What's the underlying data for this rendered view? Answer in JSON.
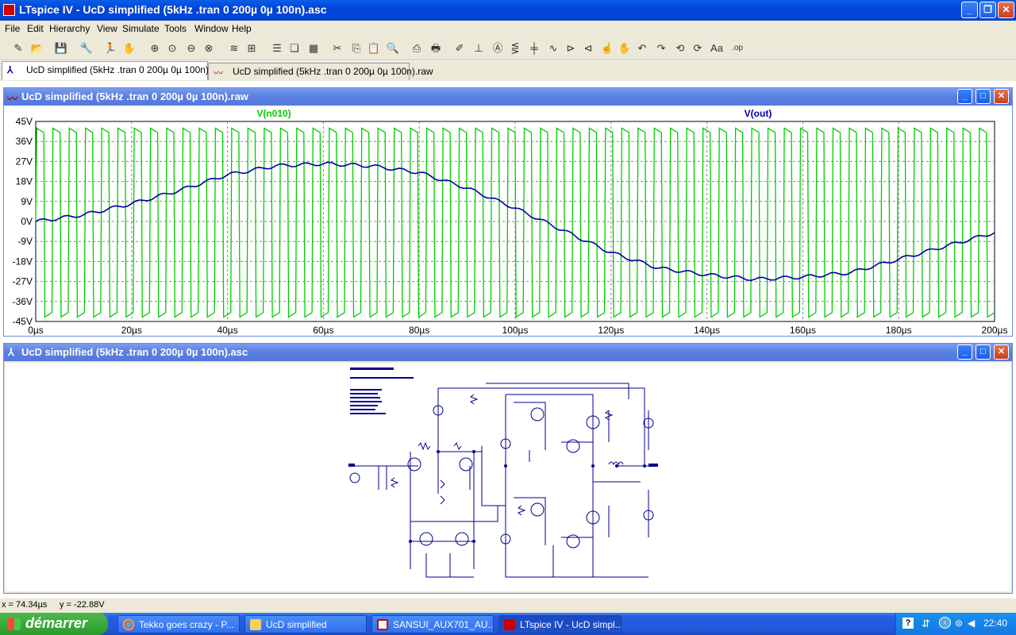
{
  "app": {
    "title": "LTspice IV - UcD simplified (5kHz .tran 0 200µ 0µ 100n).asc"
  },
  "menu": [
    "File",
    "Edit",
    "Hierarchy",
    "View",
    "Simulate",
    "Tools",
    "Window",
    "Help"
  ],
  "toolbar_icons": [
    "new-schematic-icon",
    "open-icon",
    "save-icon",
    "control-panel-icon",
    "run-icon",
    "halt-icon",
    "zoom-in-icon",
    "zoom-pan-icon",
    "zoom-out-icon",
    "zoom-fit-icon",
    "autorange-icon",
    "fft-icon",
    "tile-horizontal-icon",
    "cascade-icon",
    "tile-vertical-icon",
    "cut-icon",
    "copy-icon",
    "paste-icon",
    "find-icon",
    "print-setup-icon",
    "print-icon",
    "draw-wire-icon",
    "ground-icon",
    "label-net-icon",
    "resistor-icon",
    "capacitor-icon",
    "inductor-icon",
    "diode-icon",
    "component-icon",
    "move-icon",
    "drag-icon",
    "undo-icon",
    "redo-icon",
    "rotate-icon",
    "mirror-icon",
    "text-icon",
    "spice-directive-icon"
  ],
  "tabs": [
    {
      "label": "UcD simplified (5kHz .tran 0 200µ 0µ 100n).asc",
      "icon": "schematic-icon"
    },
    {
      "label": "UcD simplified (5kHz .tran 0 200µ 0µ 100n).raw",
      "icon": "waveform-icon"
    }
  ],
  "waveform_window": {
    "title": "UcD simplified (5kHz .tran 0 200µ 0µ 100n).raw"
  },
  "schematic_window": {
    "title": "UcD simplified (5kHz .tran 0 200µ 0µ 100n).asc"
  },
  "chart_data": {
    "type": "line",
    "title": "",
    "xlabel": "",
    "ylabel": "",
    "xlim": [
      0,
      200
    ],
    "ylim": [
      -45,
      45
    ],
    "x_ticks": [
      "0µs",
      "20µs",
      "40µs",
      "60µs",
      "80µs",
      "100µs",
      "120µs",
      "140µs",
      "160µs",
      "180µs",
      "200µs"
    ],
    "y_ticks": [
      "45V",
      "36V",
      "27V",
      "18V",
      "9V",
      "0V",
      "-9V",
      "-18V",
      "-27V",
      "-36V",
      "-45V"
    ],
    "grid": true,
    "series": [
      {
        "name": "V(n010)",
        "color": "#00cc00",
        "kind": "square",
        "high": 42,
        "low": -43,
        "cycles": 59
      },
      {
        "name": "V(out)",
        "color": "#0000aa",
        "kind": "sine",
        "amplitude": 26,
        "frequency_khz": 5,
        "x": [
          0,
          10,
          20,
          30,
          40,
          50,
          60,
          70,
          80,
          90,
          100,
          110,
          120,
          130,
          140,
          150,
          160,
          170,
          180,
          190,
          200
        ],
        "y": [
          0,
          3,
          8,
          14,
          21,
          25,
          26,
          25,
          22,
          15,
          6,
          -4,
          -14,
          -21,
          -24,
          -26,
          -25,
          -23,
          -17,
          -11,
          -5
        ]
      }
    ]
  },
  "status": {
    "x": "x = 74.34µs",
    "y": "y = -22.88V"
  },
  "taskbar": {
    "start": "démarrer",
    "tasks": [
      {
        "label": "Tekko goes crazy - P...",
        "icon": "chrome-icon"
      },
      {
        "label": "UcD simplified",
        "icon": "folder-icon"
      },
      {
        "label": "SANSUI_AUX701_AU...",
        "icon": "pdf-icon"
      },
      {
        "label": "LTspice IV - UcD simpl...",
        "icon": "ltspice-icon"
      }
    ],
    "clock": "22:40"
  }
}
